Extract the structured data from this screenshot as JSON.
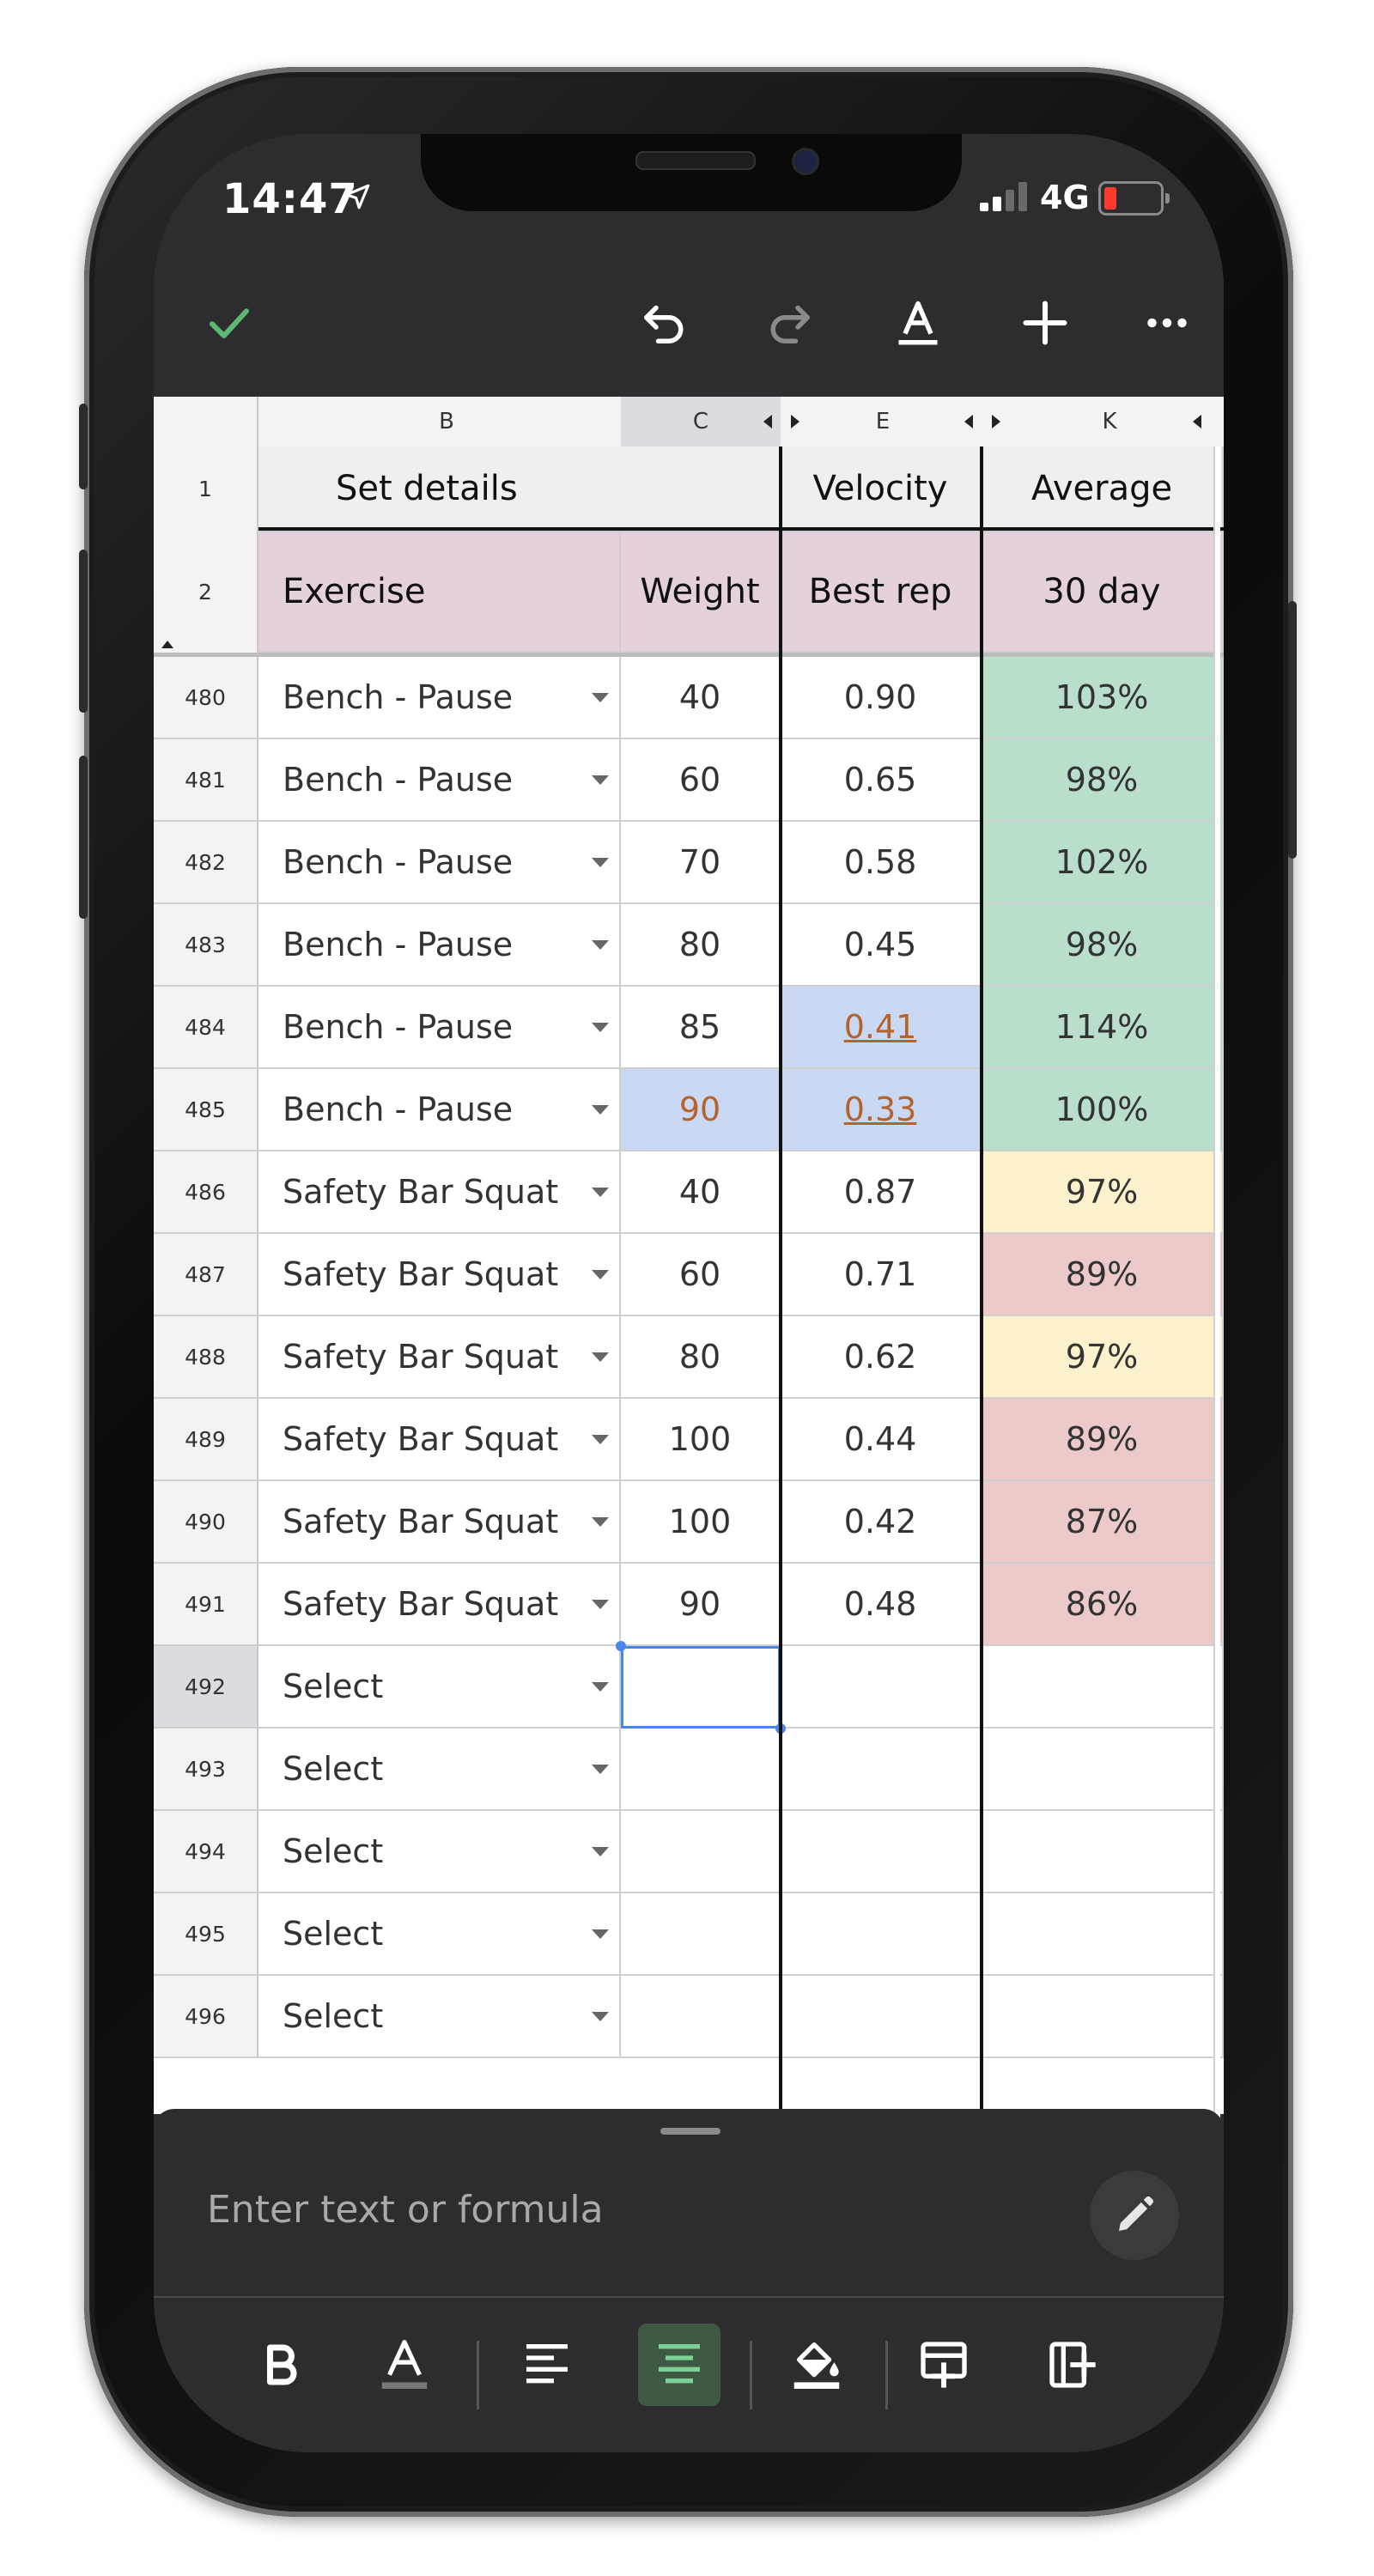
{
  "status": {
    "time": "14:47",
    "network": "4G"
  },
  "toolbar": {
    "confirm_icon": "check-icon",
    "undo_icon": "undo-icon",
    "redo_icon": "redo-icon",
    "text_format_icon": "text-format-icon",
    "insert_icon": "plus-icon",
    "more_icon": "more-icon"
  },
  "columns": [
    "B",
    "C",
    "E",
    "K"
  ],
  "header_row1": {
    "row": "1",
    "set_details": "Set details",
    "velocity": "Velocity",
    "average": "Average"
  },
  "header_row2": {
    "row": "2",
    "exercise": "Exercise",
    "weight": "Weight",
    "best_rep": "Best rep",
    "thirty_day": "30 day"
  },
  "rows": [
    {
      "n": "480",
      "exercise": "Bench - Pause",
      "weight": "40",
      "best": "0.90",
      "avg": "103%",
      "avg_color": "#b9dfcb"
    },
    {
      "n": "481",
      "exercise": "Bench - Pause",
      "weight": "60",
      "best": "0.65",
      "avg": "98%",
      "avg_color": "#b9dfcb"
    },
    {
      "n": "482",
      "exercise": "Bench - Pause",
      "weight": "70",
      "best": "0.58",
      "avg": "102%",
      "avg_color": "#b9dfcb"
    },
    {
      "n": "483",
      "exercise": "Bench - Pause",
      "weight": "80",
      "best": "0.45",
      "avg": "98%",
      "avg_color": "#b9dfcb"
    },
    {
      "n": "484",
      "exercise": "Bench - Pause",
      "weight": "85",
      "best": "0.41",
      "avg": "114%",
      "avg_color": "#b9dfcb",
      "best_hl": true
    },
    {
      "n": "485",
      "exercise": "Bench - Pause",
      "weight": "90",
      "best": "0.33",
      "avg": "100%",
      "avg_color": "#b9dfcb",
      "best_hl": true,
      "weight_hl": true
    },
    {
      "n": "486",
      "exercise": "Safety Bar Squat",
      "weight": "40",
      "best": "0.87",
      "avg": "97%",
      "avg_color": "#fbf1cc"
    },
    {
      "n": "487",
      "exercise": "Safety Bar Squat",
      "weight": "60",
      "best": "0.71",
      "avg": "89%",
      "avg_color": "#eccaca"
    },
    {
      "n": "488",
      "exercise": "Safety Bar Squat",
      "weight": "80",
      "best": "0.62",
      "avg": "97%",
      "avg_color": "#fbf1cc"
    },
    {
      "n": "489",
      "exercise": "Safety Bar Squat",
      "weight": "100",
      "best": "0.44",
      "avg": "89%",
      "avg_color": "#eccaca"
    },
    {
      "n": "490",
      "exercise": "Safety Bar Squat",
      "weight": "100",
      "best": "0.42",
      "avg": "87%",
      "avg_color": "#eccaca"
    },
    {
      "n": "491",
      "exercise": "Safety Bar Squat",
      "weight": "90",
      "best": "0.48",
      "avg": "86%",
      "avg_color": "#eccaca"
    },
    {
      "n": "492",
      "exercise": "Select",
      "weight": "",
      "best": "",
      "avg": "",
      "avg_color": "#ffffff",
      "selected": true
    },
    {
      "n": "493",
      "exercise": "Select",
      "weight": "",
      "best": "",
      "avg": "",
      "avg_color": "#ffffff"
    },
    {
      "n": "494",
      "exercise": "Select",
      "weight": "",
      "best": "",
      "avg": "",
      "avg_color": "#ffffff"
    },
    {
      "n": "495",
      "exercise": "Select",
      "weight": "",
      "best": "",
      "avg": "",
      "avg_color": "#ffffff"
    },
    {
      "n": "496",
      "exercise": "Select",
      "weight": "",
      "best": "",
      "avg": "",
      "avg_color": "#ffffff"
    }
  ],
  "colors": {
    "header_pink": "#e5d1de",
    "header_gray": "#efefef",
    "highlight_blue": "#c9d8f3",
    "link_orange": "#b5622b",
    "selection_blue": "#4a86e8",
    "accent_green": "#5bb974"
  },
  "formula_bar": {
    "placeholder": "Enter text or formula"
  }
}
